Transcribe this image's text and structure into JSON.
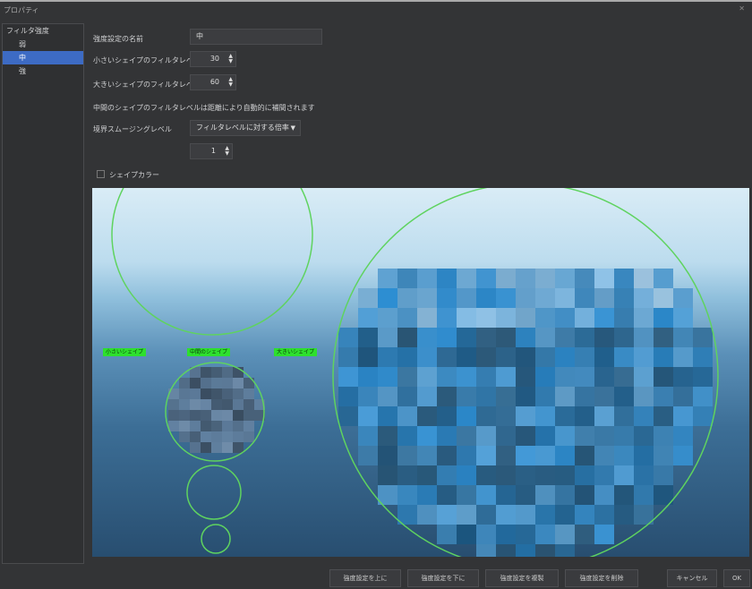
{
  "window": {
    "title": "プロパティ"
  },
  "tree": {
    "root": "フィルタ強度",
    "items": [
      {
        "label": "弱"
      },
      {
        "label": "中",
        "selected": true
      },
      {
        "label": "強"
      }
    ]
  },
  "form": {
    "name_label": "強度設定の名前",
    "name_value": "中",
    "small_label": "小さいシェイプのフィルタレベル",
    "small_value": "30",
    "large_label": "大きいシェイプのフィルタレベル",
    "large_value": "60",
    "note": "中間のシェイプのフィルタレベルは距離により自動的に補間されます",
    "smooth_label": "境界スムージングレベル",
    "smooth_mode": "フィルタレベルに対する倍率",
    "smooth_value": "1",
    "shape_color_label": "シェイプカラー",
    "shape_color_checked": false
  },
  "preview": {
    "tags": {
      "small": "小さいシェイプ",
      "medium": "中間のシェイプ",
      "large": "大きいシェイプ"
    },
    "circle_color": "#5fd35f",
    "tag_color": "#2ee02e"
  },
  "buttons": {
    "up": "強度設定を上に",
    "down": "強度設定を下に",
    "duplicate": "強度設定を複製",
    "delete": "強度設定を削除",
    "cancel": "キャンセル",
    "ok": "OK"
  }
}
